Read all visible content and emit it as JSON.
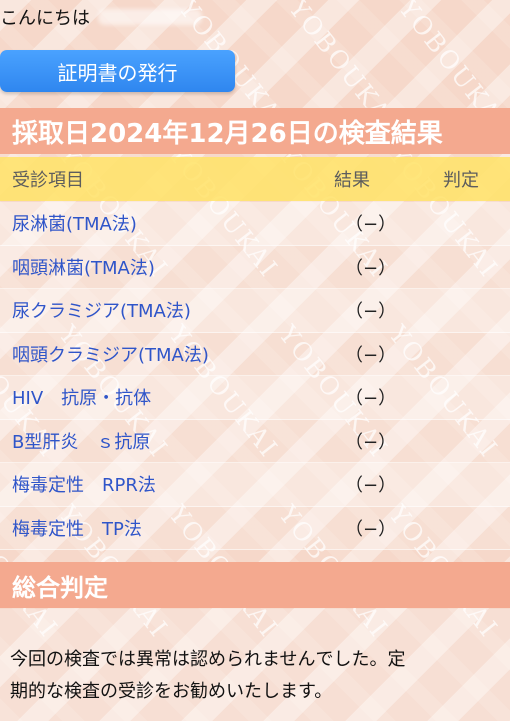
{
  "greeting": {
    "text": "こんにちは"
  },
  "actions": {
    "issue_certificate": "証明書の発行"
  },
  "results": {
    "section_title": "採取日2024年12月26日の検査結果",
    "headers": {
      "item": "受診項目",
      "result": "結果",
      "judgment": "判定"
    },
    "rows": [
      {
        "item": "尿淋菌(TMA法)",
        "result": "（−）",
        "judgment": ""
      },
      {
        "item": "咽頭淋菌(TMA法)",
        "result": "（−）",
        "judgment": ""
      },
      {
        "item": "尿クラミジア(TMA法)",
        "result": "（−）",
        "judgment": ""
      },
      {
        "item": "咽頭クラミジア(TMA法)",
        "result": "（−）",
        "judgment": ""
      },
      {
        "item": "HIV　抗原・抗体",
        "result": "（−）",
        "judgment": ""
      },
      {
        "item": "B型肝炎　ｓ抗原",
        "result": "（−）",
        "judgment": ""
      },
      {
        "item": "梅毒定性　RPR法",
        "result": "（−）",
        "judgment": ""
      },
      {
        "item": "梅毒定性　TP法",
        "result": "（−）",
        "judgment": ""
      }
    ]
  },
  "summary": {
    "section_title": "総合判定",
    "line1": "今回の検査では異常は認められませんでした。定",
    "line2": "期的な検査の受診をお勧めいたします。"
  },
  "watermark": {
    "text": "YOBOUKAI"
  },
  "colors": {
    "accent_blue": "#2f86ef",
    "section_orange": "#f4a98f",
    "header_yellow": "#ffe36a",
    "item_blue": "#2f55c9"
  }
}
